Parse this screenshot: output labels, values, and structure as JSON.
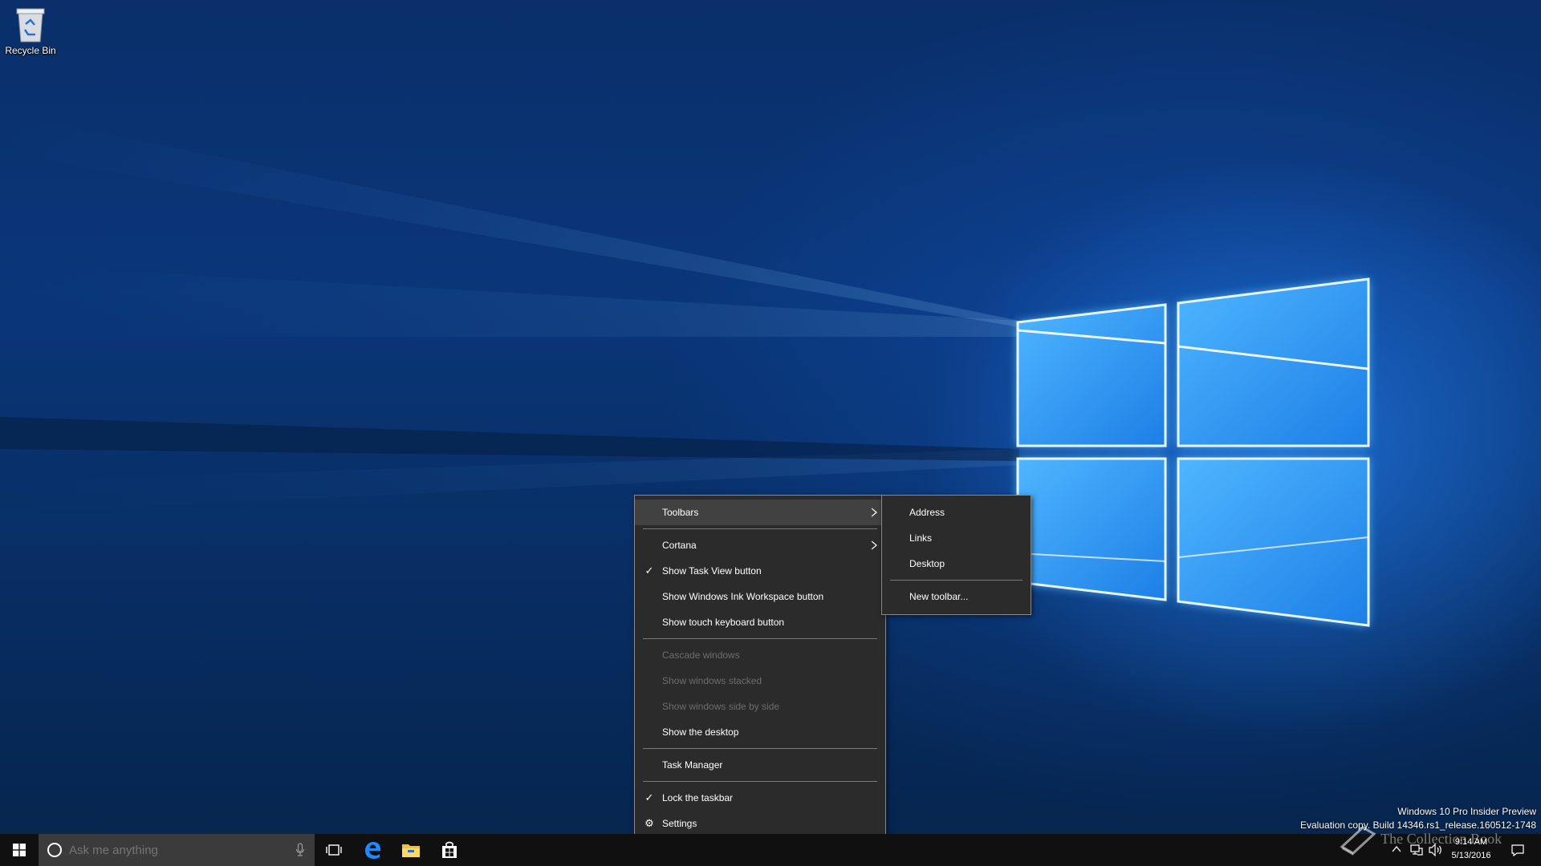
{
  "desktop": {
    "icons": [
      {
        "label": "Recycle Bin",
        "icon": "recycle-bin-icon"
      }
    ]
  },
  "context_menu": {
    "items": [
      {
        "label": "Toolbars",
        "checked": false,
        "disabled": false,
        "submenu": true,
        "highlighted": true
      },
      {
        "label": "Cortana",
        "checked": false,
        "disabled": false,
        "submenu": true
      },
      {
        "label": "Show Task View button",
        "checked": true,
        "disabled": false
      },
      {
        "label": "Show Windows Ink Workspace button",
        "checked": false,
        "disabled": false
      },
      {
        "label": "Show touch keyboard button",
        "checked": false,
        "disabled": false
      },
      {
        "label": "Cascade windows",
        "checked": false,
        "disabled": true
      },
      {
        "label": "Show windows stacked",
        "checked": false,
        "disabled": true
      },
      {
        "label": "Show windows side by side",
        "checked": false,
        "disabled": true
      },
      {
        "label": "Show the desktop",
        "checked": false,
        "disabled": false
      },
      {
        "label": "Task Manager",
        "checked": false,
        "disabled": false
      },
      {
        "label": "Lock the taskbar",
        "checked": true,
        "disabled": false
      },
      {
        "label": "Settings",
        "checked": false,
        "disabled": false,
        "icon": "gear-icon"
      }
    ]
  },
  "toolbars_submenu": {
    "items": [
      {
        "label": "Address"
      },
      {
        "label": "Links"
      },
      {
        "label": "Desktop"
      },
      {
        "label": "New toolbar..."
      }
    ]
  },
  "taskbar": {
    "search_placeholder": "Ask me anything",
    "pinned": [
      "task-view-icon",
      "edge-icon",
      "file-explorer-icon",
      "store-icon"
    ],
    "clock": {
      "time": "9:14 AM",
      "date": "5/13/2016"
    }
  },
  "watermark": {
    "line1": "Windows 10 Pro Insider Preview",
    "line2": "Evaluation copy. Build 14346.rs1_release.160512-1748"
  },
  "overlay_logo": "The Collection Book",
  "colors": {
    "menu_bg": "#2b2b2b",
    "menu_highlight": "#414141",
    "taskbar_bg": "#101010",
    "search_bg": "#3b3b3b",
    "accent": "#0078d7"
  }
}
